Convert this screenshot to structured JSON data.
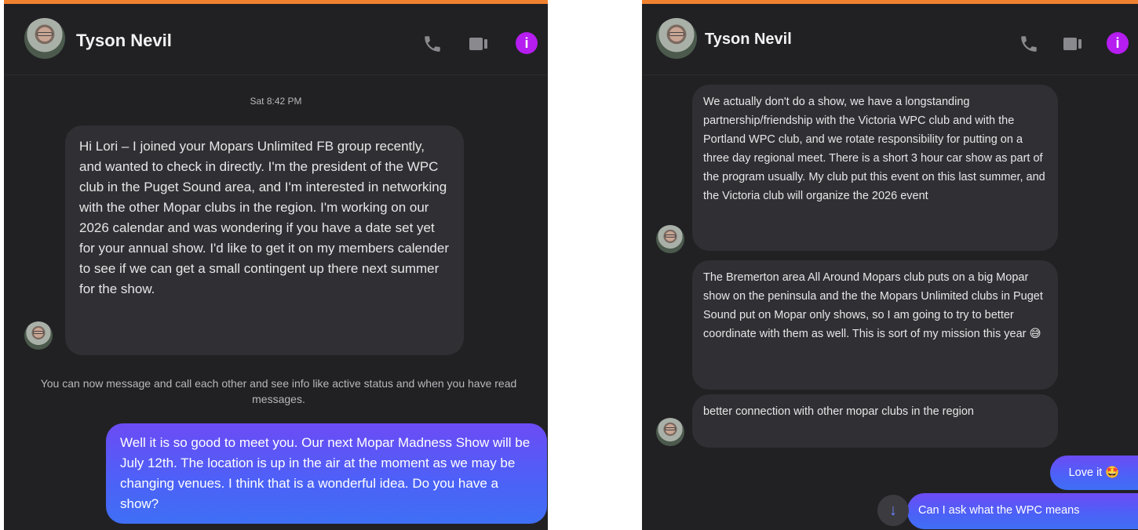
{
  "left": {
    "contact_name": "Tyson Nevil",
    "timestamp": "Sat 8:42 PM",
    "received_message": "Hi Lori – I joined your Mopars Unlimited FB group recently, and wanted to check in directly. I'm the president of the WPC club in the Puget Sound area, and I'm interested in networking with the other Mopar clubs in the region. I'm working on our 2026 calendar and was wondering if you have a date set yet for your annual show. I'd like to get it on my members calender to see if we can get a small contingent up there next summer for the show.",
    "system_note": "You can now message and call each other and see info like active status and when you have read messages.",
    "sent_message": "Well it is so good to meet you. Our next Mopar Madness Show will be July 12th. The location is up in the air at the moment as we may be changing venues. I think that is a wonderful idea. Do you have a show?"
  },
  "right": {
    "contact_name": "Tyson Nevil",
    "received_messages": [
      "We actually don't do a show, we have a longstanding partnership/friendship with the Victoria WPC club and with the Portland WPC club, and we rotate responsibility for putting on a three day regional meet. There is a short 3 hour car show as part of the program usually. My club put this event on this last summer, and the Victoria club will organize the 2026 event",
      "The Bremerton area All Around Mopars club puts on a big Mopar show on the peninsula and the the Mopars Unlimited clubs in Puget Sound put on Mopar only shows, so I am going to try to better coordinate with them as well. This is sort of my mission this year 😅",
      "better connection with other mopar clubs in the region"
    ],
    "sent_messages": [
      "Love it 🤩",
      "Can I ask what the WPC means"
    ],
    "scroll_down_icon": "arrow-down-icon"
  },
  "icons": {
    "phone": "phone-icon",
    "video": "video-camera-icon",
    "info": "info-icon",
    "info_glyph": "i"
  },
  "colors": {
    "accent_top_border": "#f0822f",
    "info_button": "#b51df0",
    "sent_bubble": "#4b62f7",
    "panel_bg": "#212124",
    "received_bubble": "#303034"
  }
}
